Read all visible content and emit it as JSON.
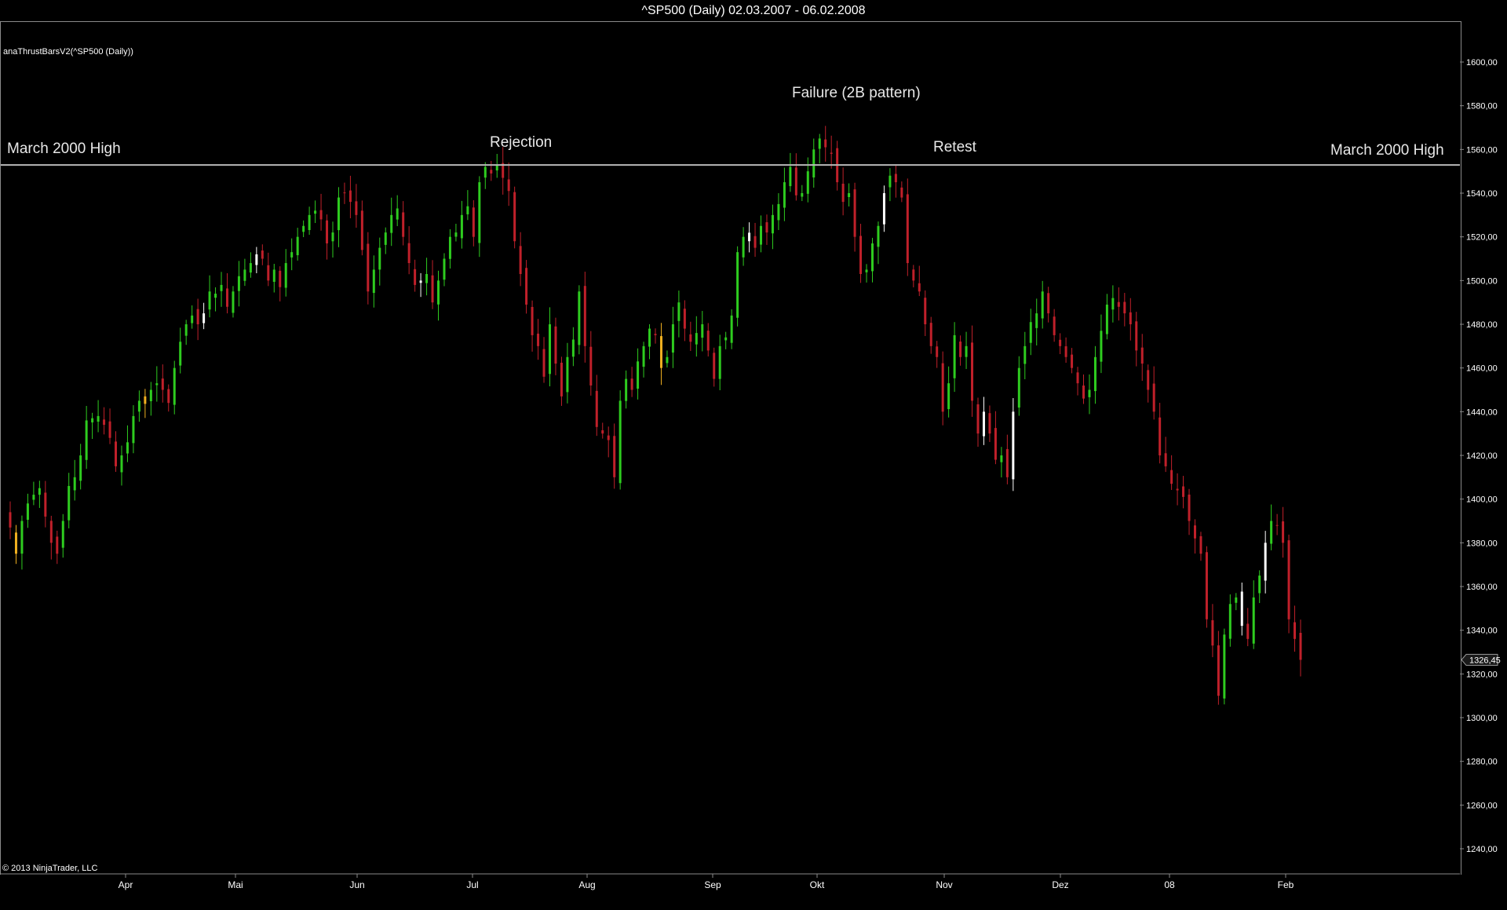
{
  "title": "^SP500 (Daily)  02.03.2007 - 06.02.2008",
  "indicator_label": "anaThrustBarsV2(^SP500 (Daily))",
  "copyright": "© 2013 NinjaTrader, LLC",
  "annotations": {
    "left": "March 2000 High",
    "right": "March 2000 High",
    "rejection": "Rejection",
    "failure": "Failure (2B pattern)",
    "retest": "Retest"
  },
  "colors": {
    "background": "#000000",
    "up": "#2ecc1f",
    "down": "#c0202a",
    "thrust_up": "#ffffff",
    "thrust_down": "#f0b020",
    "resistance_line": "#b8b8b8",
    "axis": "#8a8a8a"
  },
  "chart_data": {
    "type": "candlestick",
    "title": "^SP500 (Daily)  02.03.2007 - 06.02.2008",
    "ylim": [
      1230,
      1615
    ],
    "y_ticks": [
      "1240,00",
      "1260,00",
      "1280,00",
      "1300,00",
      "1320,00",
      "1340,00",
      "1360,00",
      "1380,00",
      "1400,00",
      "1420,00",
      "1440,00",
      "1460,00",
      "1480,00",
      "1500,00",
      "1520,00",
      "1540,00",
      "1560,00",
      "1580,00",
      "1600,00"
    ],
    "x_ticks": [
      "Apr",
      "Mai",
      "Jun",
      "Jul",
      "Aug",
      "Sep",
      "Okt",
      "Nov",
      "Dez",
      "08",
      "Feb"
    ],
    "resistance_level": 1552.9,
    "last_price": "1326,45",
    "closes": [
      1387,
      1375,
      1390,
      1398,
      1402,
      1405,
      1392,
      1380,
      1375,
      1390,
      1406,
      1410,
      1420,
      1436,
      1437,
      1438,
      1434,
      1428,
      1415,
      1420,
      1426,
      1438,
      1445,
      1447,
      1450,
      1453,
      1450,
      1444,
      1460,
      1472,
      1480,
      1484,
      1480,
      1485,
      1495,
      1494,
      1498,
      1488,
      1495,
      1502,
      1505,
      1508,
      1512,
      1510,
      1500,
      1505,
      1497,
      1508,
      1513,
      1520,
      1525,
      1530,
      1532,
      1528,
      1517,
      1522,
      1538,
      1540,
      1536,
      1530,
      1514,
      1495,
      1505,
      1515,
      1522,
      1530,
      1533,
      1520,
      1508,
      1498,
      1500,
      1503,
      1490,
      1500,
      1510,
      1520,
      1522,
      1530,
      1534,
      1520,
      1545,
      1552,
      1549,
      1553,
      1547,
      1541,
      1518,
      1503,
      1489,
      1475,
      1470,
      1456,
      1480,
      1462,
      1447,
      1465,
      1473,
      1495,
      1470,
      1452,
      1433,
      1430,
      1427,
      1410,
      1445,
      1455,
      1450,
      1463,
      1470,
      1478,
      1475,
      1460,
      1465,
      1480,
      1490,
      1478,
      1472,
      1476,
      1480,
      1468,
      1455,
      1470,
      1474,
      1484,
      1513,
      1520,
      1518,
      1515,
      1525,
      1522,
      1530,
      1535,
      1545,
      1552,
      1539,
      1540,
      1550,
      1560,
      1565,
      1561,
      1558,
      1545,
      1536,
      1540,
      1520,
      1503,
      1505,
      1517,
      1525,
      1540,
      1548,
      1545,
      1538,
      1508,
      1500,
      1495,
      1480,
      1470,
      1465,
      1440,
      1453,
      1475,
      1465,
      1470,
      1445,
      1430,
      1440,
      1430,
      1418,
      1420,
      1410,
      1440,
      1460,
      1470,
      1481,
      1485,
      1495,
      1485,
      1475,
      1470,
      1465,
      1460,
      1453,
      1446,
      1450,
      1465,
      1477,
      1489,
      1492,
      1488,
      1485,
      1480,
      1468,
      1462,
      1450,
      1440,
      1420,
      1415,
      1407,
      1404,
      1401,
      1390,
      1382,
      1375,
      1345,
      1333,
      1310,
      1338,
      1352,
      1355,
      1342,
      1336,
      1355,
      1365,
      1380,
      1390,
      1388,
      1380,
      1345,
      1336,
      1326.45
    ]
  }
}
